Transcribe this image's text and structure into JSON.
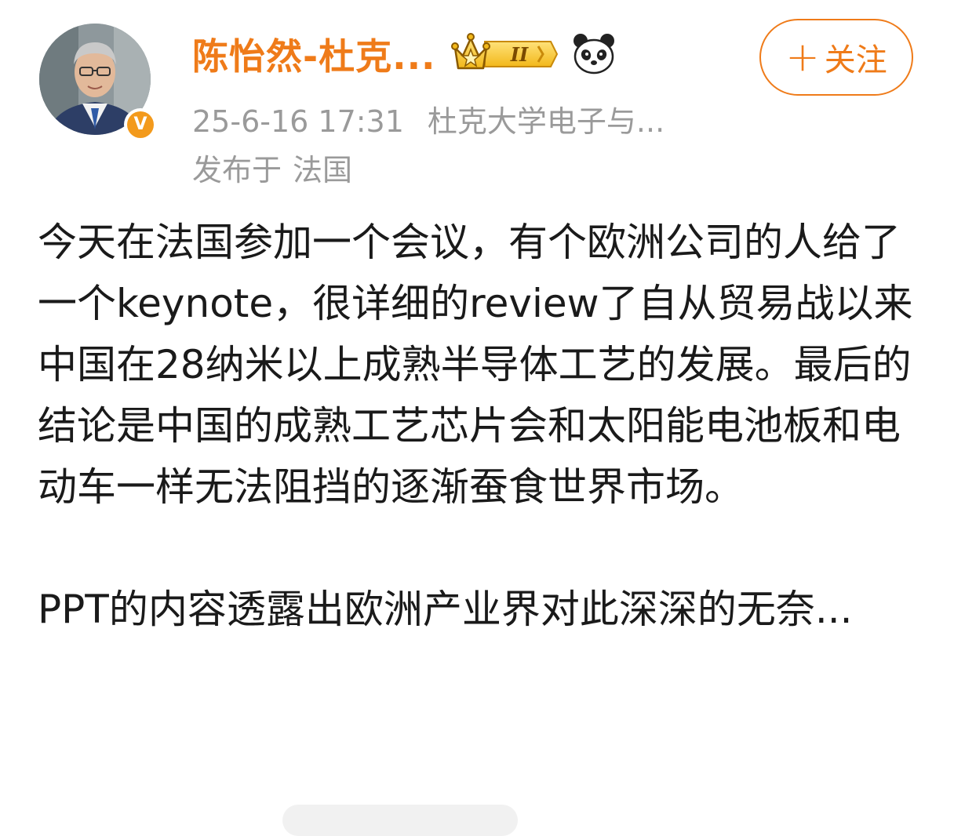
{
  "author": {
    "name": "陈怡然-杜克...",
    "vip_level": "II",
    "verified": "V"
  },
  "follow_button": {
    "plus": "+",
    "label": "关注"
  },
  "meta": {
    "timestamp": "25-6-16 17:31",
    "source": "杜克大学电子与...",
    "published_prefix": "发布于",
    "location": "法国"
  },
  "post": {
    "paragraph_1": "今天在法国参加一个会议，有个欧洲公司的人给了一个keynote，很详细的review了自从贸易战以来中国在28纳米以上成熟半导体工艺的发展。最后的结论是中国的成熟工艺芯片会和太阳能电池板和电动车一样无法阻挡的逐渐蚕食世界市场。",
    "paragraph_2": "PPT的内容透露出欧洲产业界对此深深的无奈..."
  },
  "colors": {
    "accent": "#ef7b19",
    "meta_text": "#9a9a9a",
    "body_text": "#1a1a1a",
    "badge_gold": "#f5c518",
    "verified_orange": "#f39a1c"
  },
  "icons": {
    "vip_badge": "crown-vip-badge-icon",
    "panda": "panda-icon",
    "verified": "verified-v-icon"
  }
}
